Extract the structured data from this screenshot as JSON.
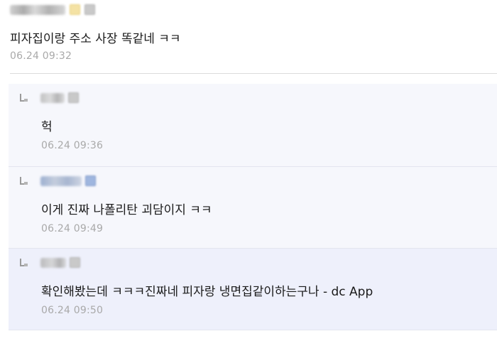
{
  "comments": [
    {
      "text": "피자집이랑 주소 사장 똑같네 ㅋㅋ",
      "time": "06.24 09:32"
    }
  ],
  "replies": [
    {
      "text": "헉",
      "time": "06.24 09:36"
    },
    {
      "text": "이게 진짜 나폴리탄 괴담이지 ㅋㅋ",
      "time": "06.24 09:49"
    },
    {
      "text": "확인해봤는데 ㅋㅋㅋ진짜네 피자랑 냉면집같이하는구나 - dc App",
      "time": "06.24 09:50"
    }
  ],
  "icons": {
    "reply": "reply-arrow-icon",
    "user_badge": "user-badge-icon"
  },
  "colors": {
    "reply_background": "#f6f7fc",
    "highlight_reply_background": "#eef0fb",
    "timestamp": "#a9a9a9"
  }
}
